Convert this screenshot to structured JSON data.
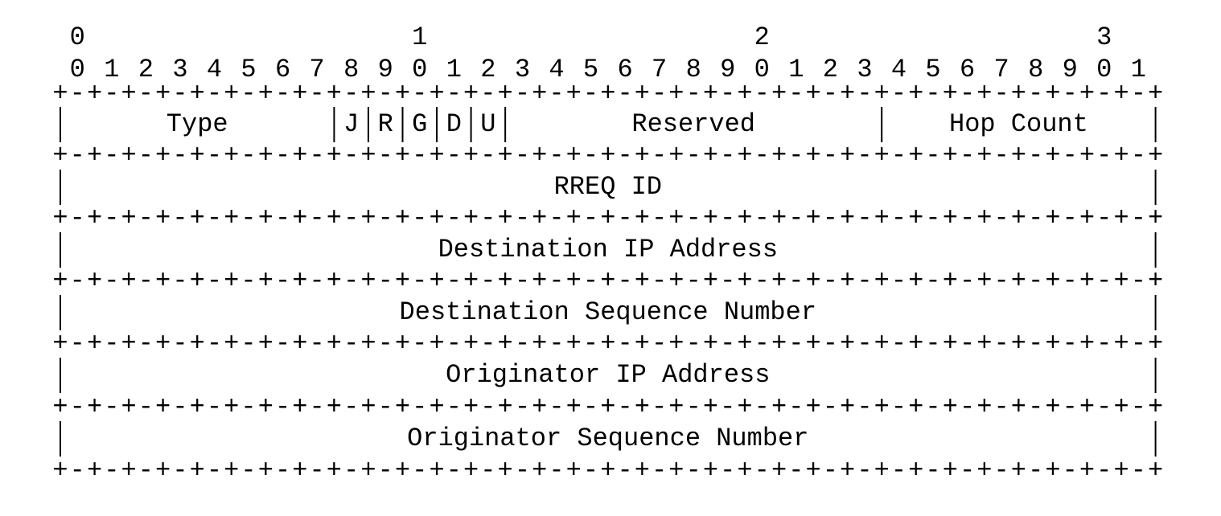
{
  "header": {
    "tens_digits": [
      "0",
      "1",
      "2",
      "3"
    ],
    "ones_digits": [
      "0",
      "1",
      "2",
      "3",
      "4",
      "5",
      "6",
      "7",
      "8",
      "9",
      "0",
      "1",
      "2",
      "3",
      "4",
      "5",
      "6",
      "7",
      "8",
      "9",
      "0",
      "1",
      "2",
      "3",
      "4",
      "5",
      "6",
      "7",
      "8",
      "9",
      "0",
      "1"
    ]
  },
  "rows": [
    {
      "fields": [
        {
          "label": "Type",
          "bits": 8
        },
        {
          "label": "J",
          "bits": 1
        },
        {
          "label": "R",
          "bits": 1
        },
        {
          "label": "G",
          "bits": 1
        },
        {
          "label": "D",
          "bits": 1
        },
        {
          "label": "U",
          "bits": 1
        },
        {
          "label": "Reserved",
          "bits": 11
        },
        {
          "label": "Hop Count",
          "bits": 8
        }
      ]
    },
    {
      "fields": [
        {
          "label": "RREQ ID",
          "bits": 32
        }
      ]
    },
    {
      "fields": [
        {
          "label": "Destination IP Address",
          "bits": 32
        }
      ]
    },
    {
      "fields": [
        {
          "label": "Destination Sequence Number",
          "bits": 32
        }
      ]
    },
    {
      "fields": [
        {
          "label": "Originator IP Address",
          "bits": 32
        }
      ]
    },
    {
      "fields": [
        {
          "label": "Originator Sequence Number",
          "bits": 32
        }
      ]
    }
  ]
}
